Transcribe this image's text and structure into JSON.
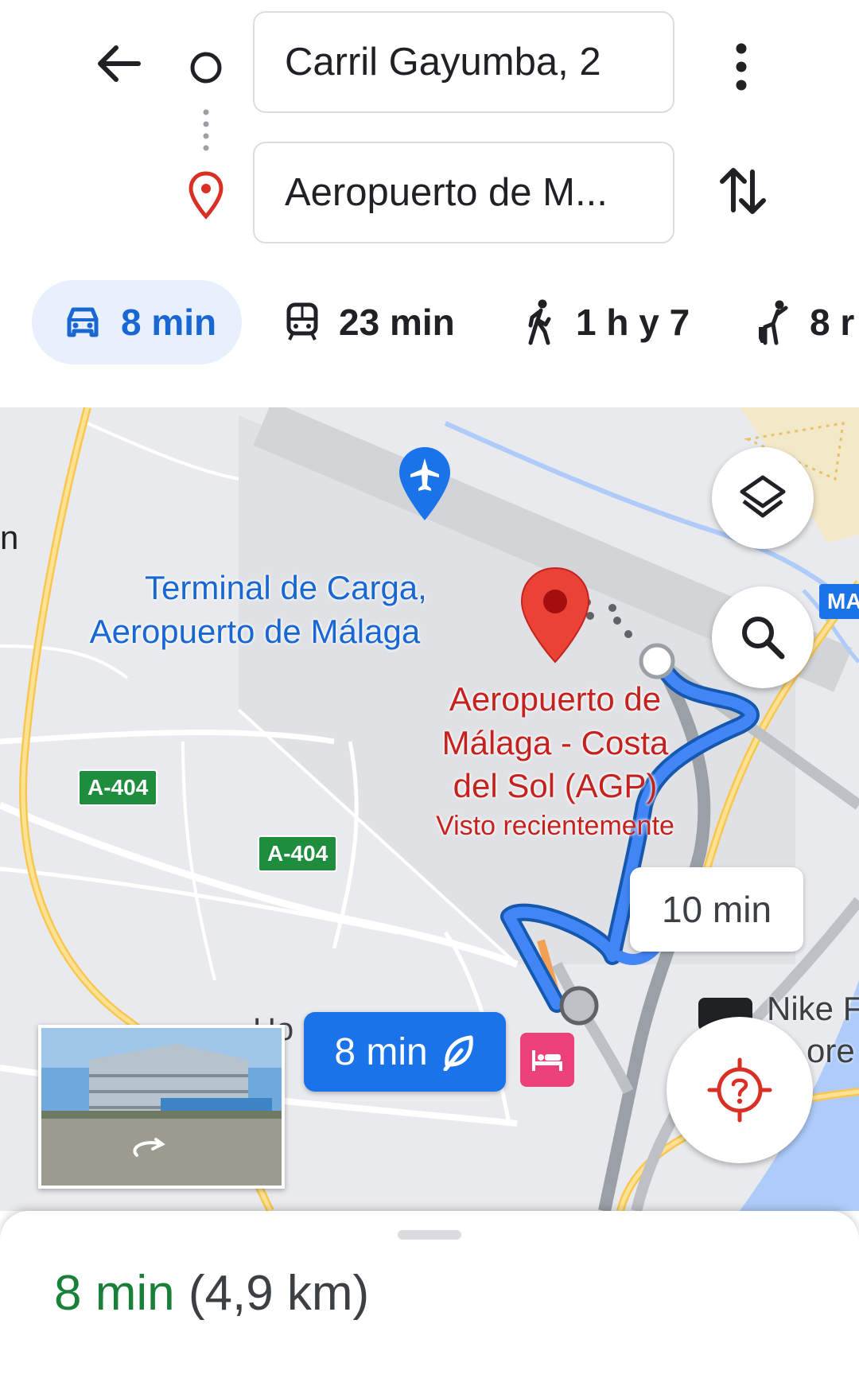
{
  "origin": {
    "value": "Carril Gayumba, 2"
  },
  "destination": {
    "value": "Aeropuerto de M..."
  },
  "travel_modes": [
    {
      "name": "car",
      "icon": "car-icon",
      "label": "8 min",
      "selected": true
    },
    {
      "name": "transit",
      "icon": "train-icon",
      "label": "23 min",
      "selected": false
    },
    {
      "name": "walk",
      "icon": "walking-icon",
      "label": "1 h y 7",
      "selected": false
    },
    {
      "name": "ride",
      "icon": "ride-icon",
      "label": "8 r",
      "selected": false
    }
  ],
  "map": {
    "places": {
      "cargo_terminal_line1": "Terminal de Carga,",
      "cargo_terminal_line2": "Aeropuerto de Málaga",
      "airport_line1": "Aeropuerto de",
      "airport_line2": "Málaga - Costa",
      "airport_line3": "del Sol (AGP)",
      "airport_note": "Visto recientemente",
      "edge_left": "n",
      "nike_line1": "Nike F",
      "nike_line2": "ore",
      "hotel_fragment": "Ho",
      "road_badge_right": "MA"
    },
    "road_shields": [
      "A-404",
      "A-404"
    ],
    "route_labels": {
      "alt_route": "10 min",
      "main_route": "8 min"
    },
    "buttons": {
      "layers": "layers-icon",
      "search": "search-icon",
      "location": "location-unknown-icon"
    }
  },
  "summary": {
    "duration": "8 min",
    "distance": "(4,9 km)"
  },
  "colors": {
    "accent_blue": "#1a73e8",
    "route_blue": "#1a73e8",
    "chip_bg": "#e8f0fe",
    "pin_red": "#ea4335",
    "place_red": "#c5221f",
    "place_blue": "#1967d2",
    "duration_green": "#188038",
    "shield_green": "#1e8e3e"
  }
}
